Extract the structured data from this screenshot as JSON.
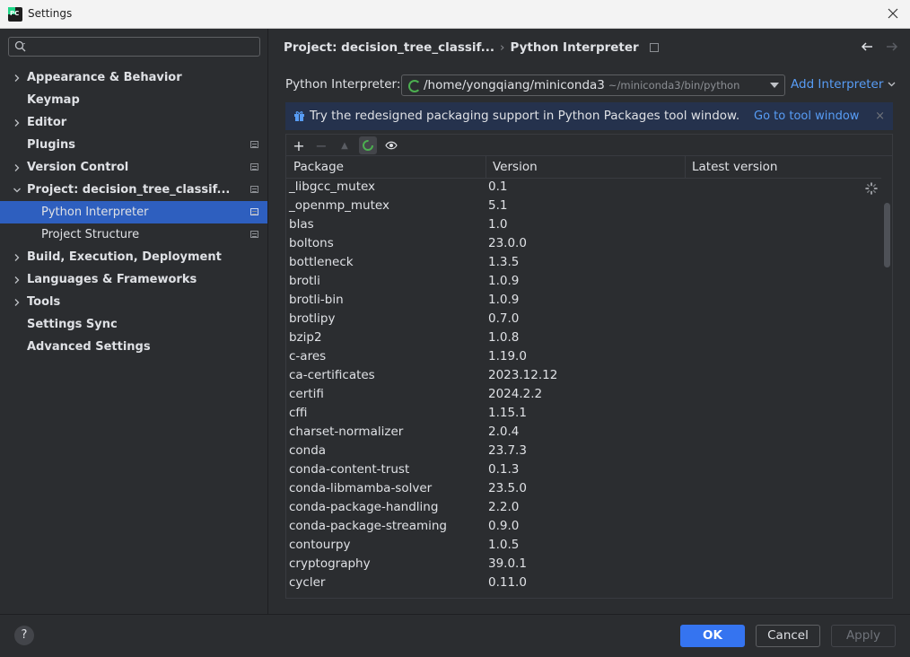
{
  "window": {
    "title": "Settings"
  },
  "search": {
    "placeholder": ""
  },
  "sidebar": {
    "items": [
      {
        "label": "Appearance & Behavior",
        "chevron": "right",
        "badge": false
      },
      {
        "label": "Keymap",
        "chevron": "none",
        "badge": false
      },
      {
        "label": "Editor",
        "chevron": "right",
        "badge": false
      },
      {
        "label": "Plugins",
        "chevron": "none",
        "badge": true
      },
      {
        "label": "Version Control",
        "chevron": "right",
        "badge": true
      },
      {
        "label": "Project: decision_tree_classif...",
        "chevron": "down",
        "badge": true
      },
      {
        "label": "Python Interpreter",
        "chevron": "none",
        "badge": true,
        "child": true,
        "selected": true
      },
      {
        "label": "Project Structure",
        "chevron": "none",
        "badge": true,
        "child": true
      },
      {
        "label": "Build, Execution, Deployment",
        "chevron": "right",
        "badge": false
      },
      {
        "label": "Languages & Frameworks",
        "chevron": "right",
        "badge": false
      },
      {
        "label": "Tools",
        "chevron": "right",
        "badge": false
      },
      {
        "label": "Settings Sync",
        "chevron": "none",
        "badge": false
      },
      {
        "label": "Advanced Settings",
        "chevron": "none",
        "badge": false
      }
    ]
  },
  "breadcrumb": {
    "project": "Project: decision_tree_classif...",
    "separator": "›",
    "page": "Python Interpreter"
  },
  "interpreter": {
    "label": "Python Interpreter:",
    "path": "/home/yongqiang/miniconda3",
    "sub_path": "~/miniconda3/bin/python",
    "add_label": "Add Interpreter"
  },
  "banner": {
    "text": "Try the redesigned packaging support in Python Packages tool window.",
    "link": "Go to tool window",
    "close": "×"
  },
  "toolbar": {
    "add": "+",
    "remove": "−",
    "up": "▲"
  },
  "table": {
    "columns": [
      "Package",
      "Version",
      "Latest version"
    ],
    "rows": [
      [
        "_libgcc_mutex",
        "0.1"
      ],
      [
        "_openmp_mutex",
        "5.1"
      ],
      [
        "blas",
        "1.0"
      ],
      [
        "boltons",
        "23.0.0"
      ],
      [
        "bottleneck",
        "1.3.5"
      ],
      [
        "brotli",
        "1.0.9"
      ],
      [
        "brotli-bin",
        "1.0.9"
      ],
      [
        "brotlipy",
        "0.7.0"
      ],
      [
        "bzip2",
        "1.0.8"
      ],
      [
        "c-ares",
        "1.19.0"
      ],
      [
        "ca-certificates",
        "2023.12.12"
      ],
      [
        "certifi",
        "2024.2.2"
      ],
      [
        "cffi",
        "1.15.1"
      ],
      [
        "charset-normalizer",
        "2.0.4"
      ],
      [
        "conda",
        "23.7.3"
      ],
      [
        "conda-content-trust",
        "0.1.3"
      ],
      [
        "conda-libmamba-solver",
        "23.5.0"
      ],
      [
        "conda-package-handling",
        "2.2.0"
      ],
      [
        "conda-package-streaming",
        "0.9.0"
      ],
      [
        "contourpy",
        "1.0.5"
      ],
      [
        "cryptography",
        "39.0.1"
      ],
      [
        "cycler",
        "0.11.0"
      ]
    ]
  },
  "footer": {
    "help": "?",
    "ok": "OK",
    "cancel": "Cancel",
    "apply": "Apply"
  },
  "colors": {
    "accent": "#3574f0",
    "selected": "#2e5fbf",
    "link": "#589df6",
    "banner_bg": "#25324d",
    "spinner": "#4caf50"
  }
}
